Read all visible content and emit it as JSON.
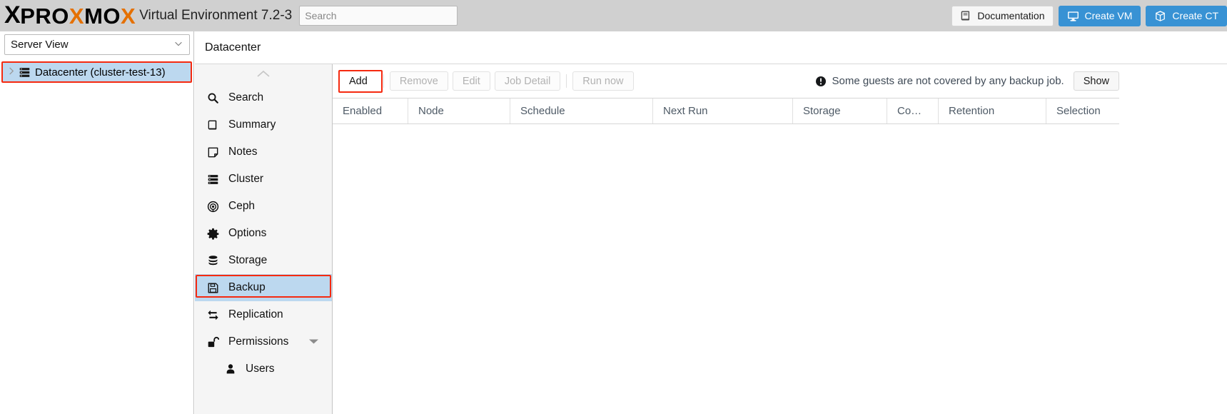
{
  "header": {
    "logo_x1": "X",
    "logo_pro": "PRO",
    "logo_x2": "X",
    "logo_mo": "MO",
    "logo_x3": "X",
    "product_title": "Virtual Environment 7.2-3",
    "search_placeholder": "Search",
    "documentation_label": "Documentation",
    "create_vm_label": "Create VM",
    "create_ct_label": "Create CT",
    "accent_blue": "#3892d4",
    "logo_orange": "#e57000",
    "bar_background": "#d0d0d0"
  },
  "tree": {
    "view_selector_label": "Server View",
    "node_label": "Datacenter (cluster-test-13)",
    "highlight_color": "#f52a10",
    "selected_background": "#bcd8ef"
  },
  "nav": {
    "items": [
      {
        "label": "Search",
        "icon": "search-icon",
        "selected": false,
        "child": false,
        "expander": false
      },
      {
        "label": "Summary",
        "icon": "book-icon",
        "selected": false,
        "child": false,
        "expander": false
      },
      {
        "label": "Notes",
        "icon": "note-icon",
        "selected": false,
        "child": false,
        "expander": false
      },
      {
        "label": "Cluster",
        "icon": "cluster-icon",
        "selected": false,
        "child": false,
        "expander": false
      },
      {
        "label": "Ceph",
        "icon": "ceph-icon",
        "selected": false,
        "child": false,
        "expander": false
      },
      {
        "label": "Options",
        "icon": "gear-icon",
        "selected": false,
        "child": false,
        "expander": false
      },
      {
        "label": "Storage",
        "icon": "storage-icon",
        "selected": false,
        "child": false,
        "expander": false
      },
      {
        "label": "Backup",
        "icon": "floppy-disk-icon",
        "selected": true,
        "child": false,
        "expander": false
      },
      {
        "label": "Replication",
        "icon": "replication-icon",
        "selected": false,
        "child": false,
        "expander": false
      },
      {
        "label": "Permissions",
        "icon": "unlock-icon",
        "selected": false,
        "child": false,
        "expander": true
      },
      {
        "label": "Users",
        "icon": "user-icon",
        "selected": false,
        "child": true,
        "expander": false
      }
    ]
  },
  "main": {
    "breadcrumb": "Datacenter",
    "toolbar": {
      "add_label": "Add",
      "remove_label": "Remove",
      "edit_label": "Edit",
      "job_detail_label": "Job Detail",
      "run_now_label": "Run now"
    },
    "warning": {
      "message": "Some guests are not covered by any backup job.",
      "show_label": "Show"
    },
    "table": {
      "columns": [
        "Enabled",
        "Node",
        "Schedule",
        "Next Run",
        "Storage",
        "Co…",
        "Retention",
        "Selection"
      ],
      "rows": []
    }
  }
}
